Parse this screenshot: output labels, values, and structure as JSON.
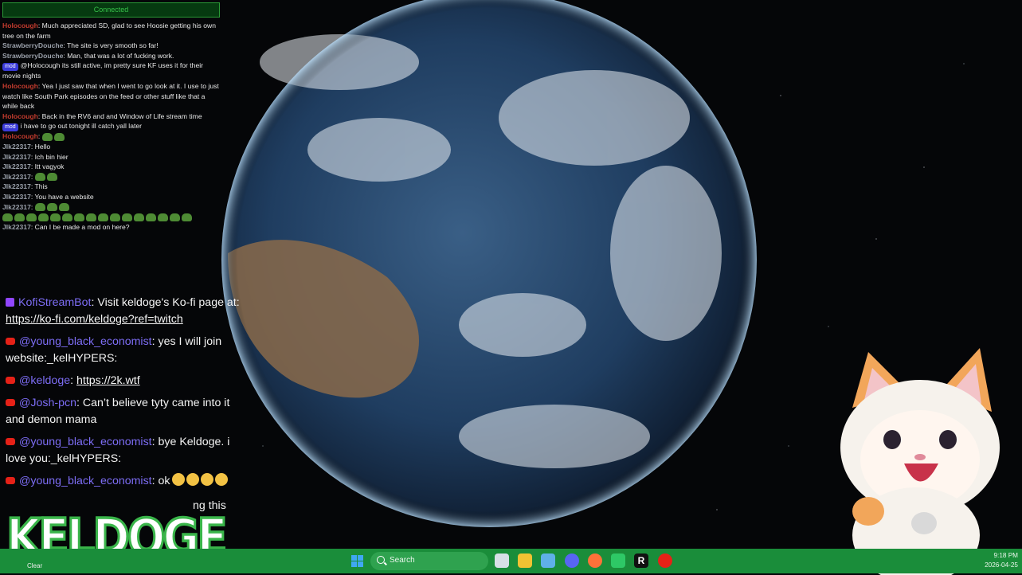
{
  "top_chat": {
    "status": "Connected",
    "messages": [
      {
        "user": "Holocough",
        "text": "Much appreciated SD, glad to see Hoosie getting his own tree on the farm",
        "color": "#c23b2e"
      },
      {
        "user": "StrawberryDouche",
        "text": "The site is very smooth so far!",
        "color": "#9aa0aa"
      },
      {
        "user": "StrawberryDouche",
        "text": "Man, that was a lot of fucking work.",
        "color": "#9aa0aa"
      },
      {
        "user": "",
        "badge": "mod",
        "text": "@Holocough its still active, im pretty sure KF uses it for their movie nights",
        "color": "#9aa0aa"
      },
      {
        "user": "Holocough",
        "text": "Yea I just saw that when I went to go look at it.  I use to just watch like South Park episodes on the feed or other stuff like that a while back",
        "color": "#c23b2e"
      },
      {
        "user": "Holocough",
        "text": "Back in the RV6 and and Window of Life stream time",
        "color": "#c23b2e"
      },
      {
        "user": "",
        "badge": "mod",
        "text": "i have to go out tonight ill catch yall later",
        "color": "#9aa0aa"
      },
      {
        "user": "Holocough",
        "text": "",
        "color": "#c23b2e"
      },
      {
        "user": "Jlk22317",
        "text": "Hello",
        "color": "#9aa0aa"
      },
      {
        "user": "Jlk22317",
        "text": "Ich bin hier",
        "color": "#9aa0aa"
      },
      {
        "user": "Jlk22317",
        "text": "Itt vagyok",
        "color": "#9aa0aa"
      },
      {
        "user": "Jlk22317",
        "text": "",
        "color": "#9aa0aa"
      },
      {
        "user": "Jlk22317",
        "text": "This",
        "color": "#9aa0aa"
      },
      {
        "user": "Jlk22317",
        "text": "You have a website",
        "color": "#9aa0aa"
      },
      {
        "user": "Jlk22317",
        "text": "",
        "color": "#9aa0aa"
      },
      {
        "user": "Jlk22317",
        "text": "Can I be made a mod on here?",
        "color": "#9aa0aa"
      }
    ]
  },
  "lower_chat": {
    "messages": [
      {
        "platform": "twitch",
        "user": "KofiStreamBot",
        "text": "Visit keldoge's Ko-fi page at: ",
        "link": "https://ko-fi.com/keldoge?ref=twitch"
      },
      {
        "platform": "youtube",
        "user": "@young_black_economist",
        "text": "yes I will join website:_kelHYPERS:",
        "link": ""
      },
      {
        "platform": "youtube",
        "user": "@keldoge",
        "text": "",
        "link": "https://2k.wtf"
      },
      {
        "platform": "youtube",
        "user": "@Josh-pcn",
        "text": "Can’t believe tyty came into it and demon mama",
        "link": ""
      },
      {
        "platform": "youtube",
        "user": "@young_black_economist",
        "text": "bye Keldoge. i love you:_kelHYPERS:",
        "link": ""
      },
      {
        "platform": "youtube",
        "user": "@young_black_economist",
        "text": "ok",
        "link": ""
      }
    ],
    "partial_text": "ng this",
    "partial_link": "https://www.youtube.com/watch?"
  },
  "logo": "KELDOGE",
  "taskbar": {
    "search_label": "Search",
    "clear_label": "Clear",
    "time": "9:18 PM",
    "date": "2026-04-25"
  }
}
